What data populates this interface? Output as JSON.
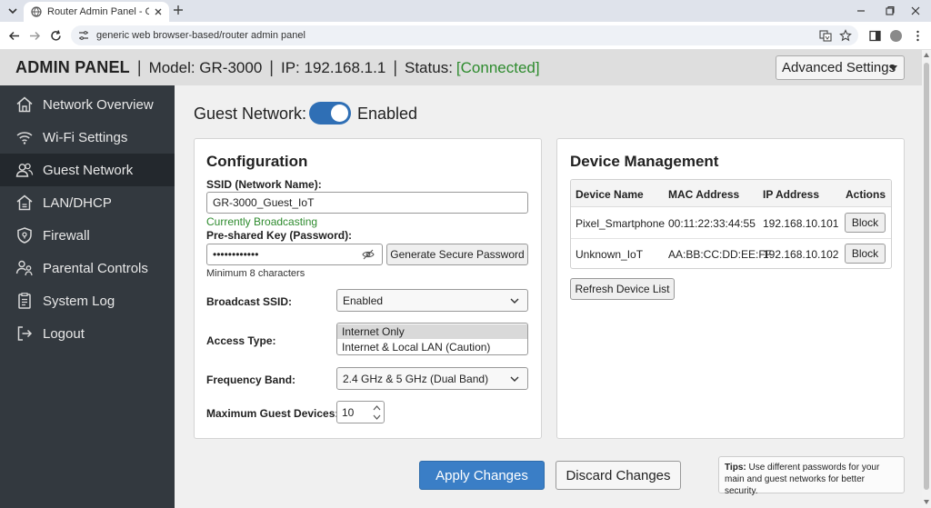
{
  "browser": {
    "tab_title": "Router Admin Panel - Guest Network",
    "address": "generic web browser-based/router admin panel"
  },
  "header": {
    "title": "ADMIN PANEL",
    "separator": "|",
    "model": "Model: GR-3000",
    "ip": "IP: 192.168.1.1",
    "status_label": "Status:",
    "status_value": "[Connected]",
    "advanced_settings": "Advanced Settings",
    "status_color": "#2e8b2e"
  },
  "sidebar": {
    "items": [
      {
        "label": "Network Overview",
        "icon": "home-icon"
      },
      {
        "label": "Wi-Fi Settings",
        "icon": "wifi-icon"
      },
      {
        "label": "Guest Network",
        "icon": "users-icon",
        "active": true
      },
      {
        "label": "LAN/DHCP",
        "icon": "house-network-icon"
      },
      {
        "label": "Firewall",
        "icon": "shield-icon"
      },
      {
        "label": "Parental Controls",
        "icon": "parental-icon"
      },
      {
        "label": "System Log",
        "icon": "log-icon"
      },
      {
        "label": "Logout",
        "icon": "logout-icon"
      }
    ]
  },
  "guest": {
    "label": "Guest Network:",
    "toggle_on": true,
    "state": "Enabled"
  },
  "config": {
    "title": "Configuration",
    "ssid_label": "SSID (Network Name):",
    "ssid_value": "GR-3000_Guest_IoT",
    "broadcast_note": "Currently Broadcasting",
    "psk_label": "Pre-shared Key (Password):",
    "psk_value": "••••••••••••",
    "generate_btn": "Generate Secure Password",
    "psk_hint": "Minimum 8 characters",
    "broadcast_label": "Broadcast SSID:",
    "broadcast_value": "Enabled",
    "access_label": "Access Type:",
    "access_options": [
      "Internet Only",
      "Internet & Local LAN (Caution)"
    ],
    "access_selected": "Internet Only",
    "freq_label": "Frequency Band:",
    "freq_value": "2.4 GHz & 5 GHz (Dual Band)",
    "max_label": "Maximum Guest Devices:",
    "max_value": "10"
  },
  "devices": {
    "title": "Device Management",
    "columns": [
      "Device Name",
      "MAC Address",
      "IP Address",
      "Actions"
    ],
    "rows": [
      {
        "name": "Pixel_Smartphone",
        "mac": "00:11:22:33:44:55",
        "ip": "192.168.10.101",
        "action": "Block"
      },
      {
        "name": "Unknown_IoT",
        "mac": "AA:BB:CC:DD:EE:FF",
        "ip": "192.168.10.102",
        "action": "Block"
      }
    ],
    "refresh_btn": "Refresh Device List"
  },
  "actions": {
    "apply": "Apply Changes",
    "discard": "Discard Changes",
    "accent": "#3a7ec6"
  },
  "tips": {
    "label": "Tips:",
    "text": "Use different passwords for your main and guest networks for better security."
  }
}
